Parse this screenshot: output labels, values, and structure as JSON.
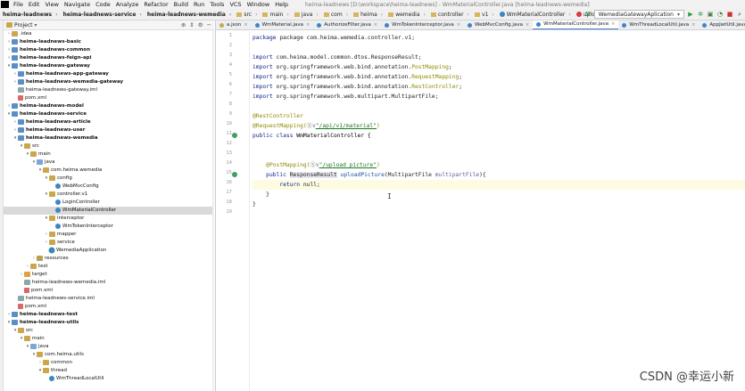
{
  "menubar": {
    "items": [
      "File",
      "Edit",
      "View",
      "Navigate",
      "Code",
      "Analyze",
      "Refactor",
      "Build",
      "Run",
      "Tools",
      "VCS",
      "Window",
      "Help"
    ],
    "window_title": "heima-leadnews [D:\\workspace\\heima-leadnews] - WmMaterialController.java [heima-leadnews-wemedia]"
  },
  "breadcrumb": [
    "heima-leadnews",
    "heima-leadnews-service",
    "heima-leadnews-wemedia",
    "src",
    "main",
    "java",
    "com",
    "heima",
    "wemedia",
    "controller",
    "v1",
    "WmMaterialController",
    "uploadPicture"
  ],
  "run_config": "WemediaGatewayAplication",
  "project_panel": {
    "title": "Project"
  },
  "tree": [
    {
      "label": ".idea",
      "indent": 1,
      "arrow": ">",
      "icon": "folder",
      "bold": false
    },
    {
      "label": "heima-leadnews-basic",
      "indent": 1,
      "arrow": ">",
      "icon": "module",
      "bold": true
    },
    {
      "label": "heima-leadnews-common",
      "indent": 1,
      "arrow": ">",
      "icon": "module",
      "bold": true
    },
    {
      "label": "heima-leadnews-feign-api",
      "indent": 1,
      "arrow": ">",
      "icon": "module",
      "bold": true
    },
    {
      "label": "heima-leadnews-gateway",
      "indent": 1,
      "arrow": "v",
      "icon": "module",
      "bold": true
    },
    {
      "label": "heima-leadnews-app-gateway",
      "indent": 2,
      "arrow": ">",
      "icon": "module",
      "bold": true
    },
    {
      "label": "heima-leadnews-wemedia-gateway",
      "indent": 2,
      "arrow": ">",
      "icon": "module",
      "bold": true
    },
    {
      "label": "heima-leadnews-gateway.iml",
      "indent": 2,
      "arrow": "",
      "icon": "iml",
      "bold": false
    },
    {
      "label": "pom.xml",
      "indent": 2,
      "arrow": "",
      "icon": "xml",
      "bold": false
    },
    {
      "label": "heima-leadnews-model",
      "indent": 1,
      "arrow": ">",
      "icon": "module",
      "bold": true
    },
    {
      "label": "heima-leadnews-service",
      "indent": 1,
      "arrow": "v",
      "icon": "module",
      "bold": true
    },
    {
      "label": "heima-leadnews-article",
      "indent": 2,
      "arrow": ">",
      "icon": "module",
      "bold": true
    },
    {
      "label": "heima-leadnews-user",
      "indent": 2,
      "arrow": ">",
      "icon": "module",
      "bold": true
    },
    {
      "label": "heima-leadnews-wemedia",
      "indent": 2,
      "arrow": "v",
      "icon": "module",
      "bold": true
    },
    {
      "label": "src",
      "indent": 3,
      "arrow": "v",
      "icon": "folder",
      "bold": false
    },
    {
      "label": "main",
      "indent": 4,
      "arrow": "v",
      "icon": "folder",
      "bold": false
    },
    {
      "label": "java",
      "indent": 5,
      "arrow": "v",
      "icon": "src",
      "bold": false
    },
    {
      "label": "com.heima.wemedia",
      "indent": 6,
      "arrow": "v",
      "icon": "folder",
      "bold": false
    },
    {
      "label": "config",
      "indent": 7,
      "arrow": "v",
      "icon": "folder",
      "bold": false
    },
    {
      "label": "WebMvcConfig",
      "indent": 8,
      "arrow": "",
      "icon": "class",
      "bold": false
    },
    {
      "label": "controller.v1",
      "indent": 7,
      "arrow": "v",
      "icon": "folder",
      "bold": false
    },
    {
      "label": "LoginController",
      "indent": 8,
      "arrow": "",
      "icon": "class",
      "bold": false
    },
    {
      "label": "WmMaterialController",
      "indent": 8,
      "arrow": "",
      "icon": "class",
      "bold": false,
      "selected": true
    },
    {
      "label": "interceptor",
      "indent": 7,
      "arrow": "v",
      "icon": "folder",
      "bold": false
    },
    {
      "label": "WmTokenInterceptor",
      "indent": 8,
      "arrow": "",
      "icon": "class",
      "bold": false
    },
    {
      "label": "mapper",
      "indent": 7,
      "arrow": ">",
      "icon": "folder",
      "bold": false
    },
    {
      "label": "service",
      "indent": 7,
      "arrow": ">",
      "icon": "folder",
      "bold": false
    },
    {
      "label": "WemediaApplication",
      "indent": 7,
      "arrow": "",
      "icon": "app",
      "bold": false
    },
    {
      "label": "resources",
      "indent": 5,
      "arrow": ">",
      "icon": "res",
      "bold": false
    },
    {
      "label": "test",
      "indent": 4,
      "arrow": ">",
      "icon": "folder",
      "bold": false
    },
    {
      "label": "target",
      "indent": 3,
      "arrow": ">",
      "icon": "target",
      "bold": false
    },
    {
      "label": "heima-leadnews-wemedia.iml",
      "indent": 3,
      "arrow": "",
      "icon": "iml",
      "bold": false
    },
    {
      "label": "pom.xml",
      "indent": 3,
      "arrow": "",
      "icon": "xml",
      "bold": false
    },
    {
      "label": "heima-leadnews-service.iml",
      "indent": 2,
      "arrow": "",
      "icon": "iml",
      "bold": false
    },
    {
      "label": "pom.xml",
      "indent": 2,
      "arrow": "",
      "icon": "xml",
      "bold": false
    },
    {
      "label": "heima-leadnews-test",
      "indent": 1,
      "arrow": ">",
      "icon": "module",
      "bold": true
    },
    {
      "label": "heima-leadnews-utils",
      "indent": 1,
      "arrow": "v",
      "icon": "module",
      "bold": true
    },
    {
      "label": "src",
      "indent": 2,
      "arrow": "v",
      "icon": "folder",
      "bold": false
    },
    {
      "label": "main",
      "indent": 3,
      "arrow": "v",
      "icon": "folder",
      "bold": false
    },
    {
      "label": "java",
      "indent": 4,
      "arrow": "v",
      "icon": "src",
      "bold": false
    },
    {
      "label": "com.heima.utils",
      "indent": 5,
      "arrow": "v",
      "icon": "folder",
      "bold": false
    },
    {
      "label": "common",
      "indent": 6,
      "arrow": ">",
      "icon": "folder",
      "bold": false
    },
    {
      "label": "thread",
      "indent": 6,
      "arrow": "v",
      "icon": "folder",
      "bold": false
    },
    {
      "label": "WmThreadLocalUtil",
      "indent": 7,
      "arrow": "",
      "icon": "class",
      "bold": false
    }
  ],
  "tabs": [
    {
      "label": "a.json",
      "dot": "#c9a74a",
      "active": false
    },
    {
      "label": "WmMaterial.java",
      "dot": "#3d85c6",
      "active": false
    },
    {
      "label": "AuthorizeFilter.java",
      "dot": "#3d85c6",
      "active": false
    },
    {
      "label": "WmTokenInterceptor.java",
      "dot": "#3d85c6",
      "active": false
    },
    {
      "label": "WebMvcConfig.java",
      "dot": "#3d85c6",
      "active": false
    },
    {
      "label": "WmMaterialController.java",
      "dot": "#3d85c6",
      "active": true
    },
    {
      "label": "WmThreadLocalUtil.java",
      "dot": "#3d85c6",
      "active": false
    },
    {
      "label": "AppJwtUtil.java",
      "dot": "#3d85c6",
      "active": false
    }
  ],
  "code": {
    "line1": "package com.heima.wemedia.controller.v1;",
    "imp1": "com.heima.model.common.dtos.ResponseResult;",
    "imp2a": "org.springframework.web.bind.annotation.",
    "imp2b": "PostMapping",
    "imp3a": "org.springframework.web.bind.annotation.",
    "imp3b": "RequestMapping",
    "imp4a": "org.springframework.web.bind.annotation.",
    "imp4b": "RestController",
    "imp5": "org.springframework.web.multipart.MultipartFile;",
    "restctl": "@RestController",
    "reqmap": "@RequestMapping(",
    "reqmap_icon": "Ⓢ∨",
    "reqmap_path": "\"/api/v1/material\"",
    "classdecl_kw": "public class ",
    "classdecl_name": "WmMaterialController {",
    "postmap": "@PostMapping(",
    "postmap_path": "\"/upload_picture\"",
    "method_kw": "public ",
    "method_rtype": "ResponseResult",
    "method_name": "uploadPicture",
    "method_params": "(MultipartFile ",
    "method_param_name": "multipartFile",
    "method_end": "){",
    "ret_kw": "return ",
    "ret_val": "null;",
    "close1": "}",
    "close2": "}",
    "kw_package": "package ",
    "kw_import": "import "
  },
  "line_numbers": [
    "1",
    "2",
    "3",
    "4",
    "5",
    "6",
    "7",
    "8",
    "9",
    "10",
    "11",
    "12",
    "13",
    "14",
    "15",
    "16",
    "17",
    "18",
    "19"
  ],
  "watermark": "CSDN @幸运小新"
}
